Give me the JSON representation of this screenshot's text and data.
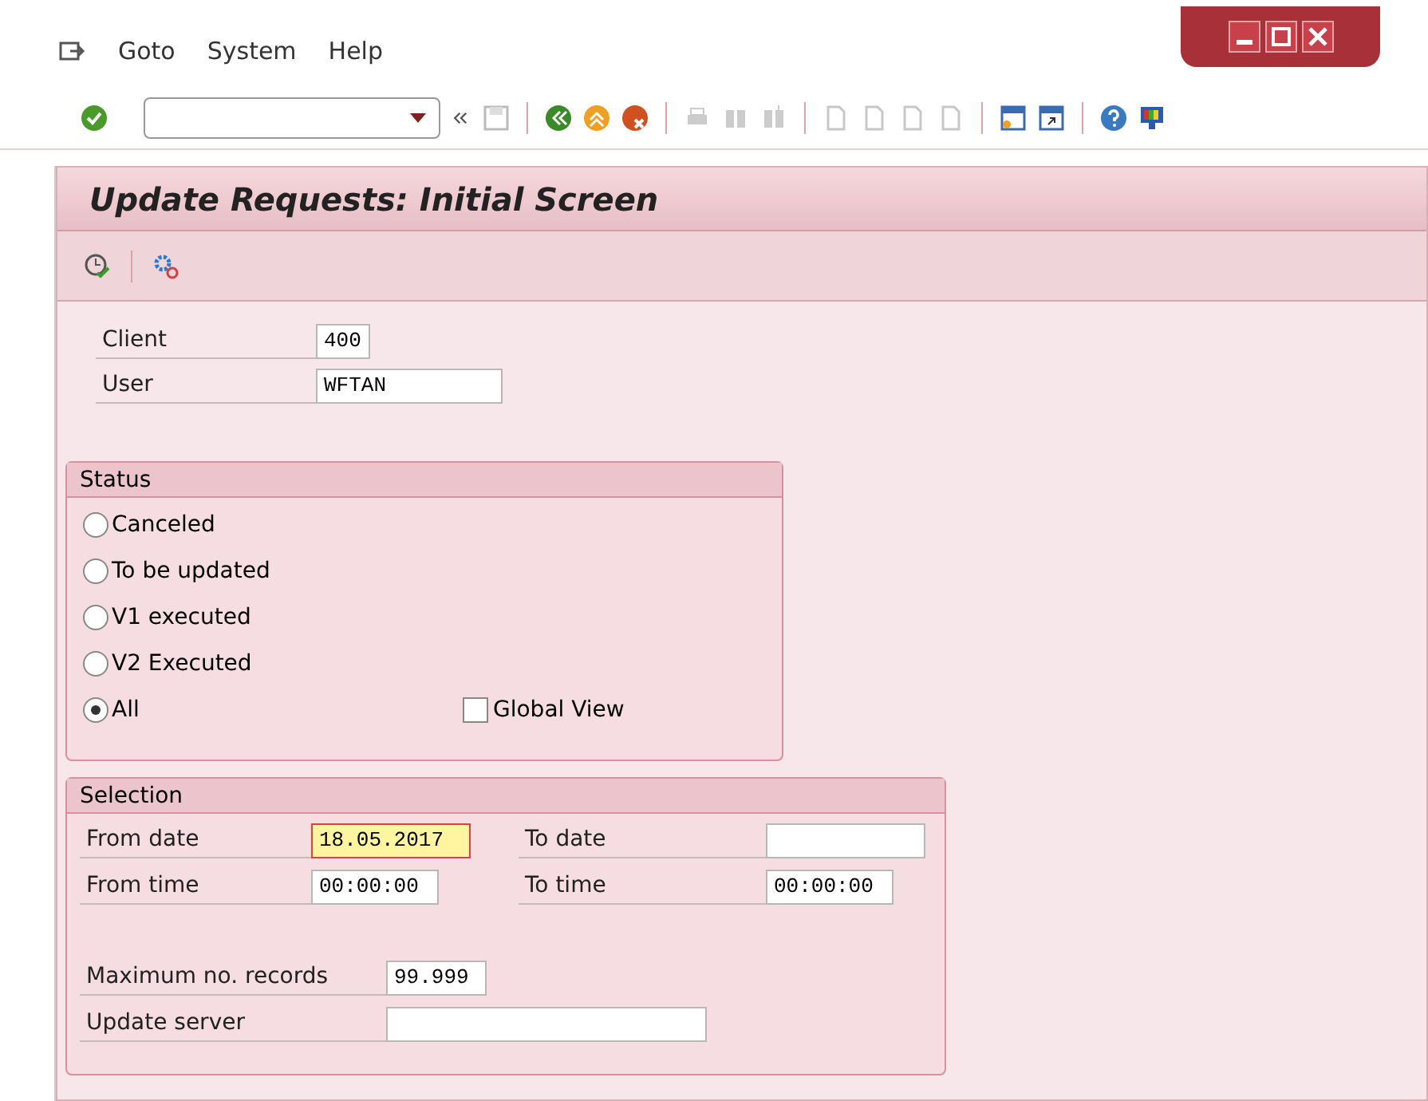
{
  "menu": [
    "Goto",
    "System",
    "Help"
  ],
  "title": "Update Requests: Initial Screen",
  "header_fields": [
    {
      "label": "Client",
      "value": "400"
    },
    {
      "label": "User",
      "value": "WFTAN"
    }
  ],
  "status": {
    "title": "Status",
    "options": [
      {
        "label": "Canceled",
        "selected": false
      },
      {
        "label": "To be updated",
        "selected": false
      },
      {
        "label": "V1 executed",
        "selected": false
      },
      {
        "label": "V2 Executed",
        "selected": false
      },
      {
        "label": "All",
        "selected": true
      }
    ],
    "global_view": {
      "label": "Global View",
      "checked": false
    }
  },
  "selection": {
    "title": "Selection",
    "rows": [
      [
        {
          "label": "From date",
          "value": "18.05.2017",
          "focused": true
        },
        {
          "label": "To date",
          "focused": false
        }
      ],
      [
        {
          "label": "From time",
          "value": "00:00:00",
          "focused": false
        },
        {
          "label": "To time",
          "value": "00:00:00",
          "focused": false
        }
      ]
    ],
    "max_records": {
      "label": "Maximum no. records",
      "value": "99.999"
    },
    "update_server": {
      "label": "Update server"
    }
  }
}
